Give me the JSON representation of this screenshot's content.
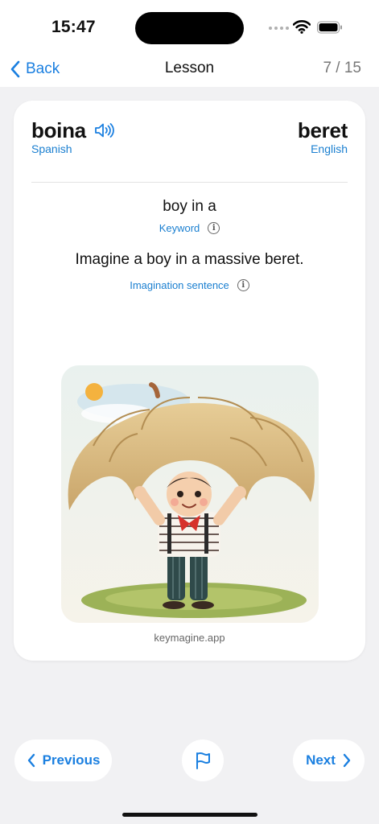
{
  "status": {
    "time": "15:47"
  },
  "nav": {
    "back_label": "Back",
    "title": "Lesson",
    "progress": "7 / 15"
  },
  "card": {
    "source_word": "boina",
    "source_lang": "Spanish",
    "target_word": "beret",
    "target_lang": "English",
    "keyword": "boy in a",
    "keyword_label": "Keyword",
    "sentence": "Imagine a boy in a massive beret.",
    "sentence_label": "Imagination sentence",
    "info_glyph": "i",
    "image_caption": "keymagine.app"
  },
  "footer": {
    "previous_label": "Previous",
    "next_label": "Next"
  },
  "colors": {
    "accent": "#1a7fe0",
    "label_blue": "#1a7fd0",
    "background": "#f1f1f3"
  },
  "icons": [
    "back-chevron-icon",
    "speaker-icon",
    "info-icon",
    "flag-icon",
    "chevron-left-icon",
    "chevron-right-icon",
    "wifi-icon",
    "battery-icon",
    "signal-icon"
  ]
}
